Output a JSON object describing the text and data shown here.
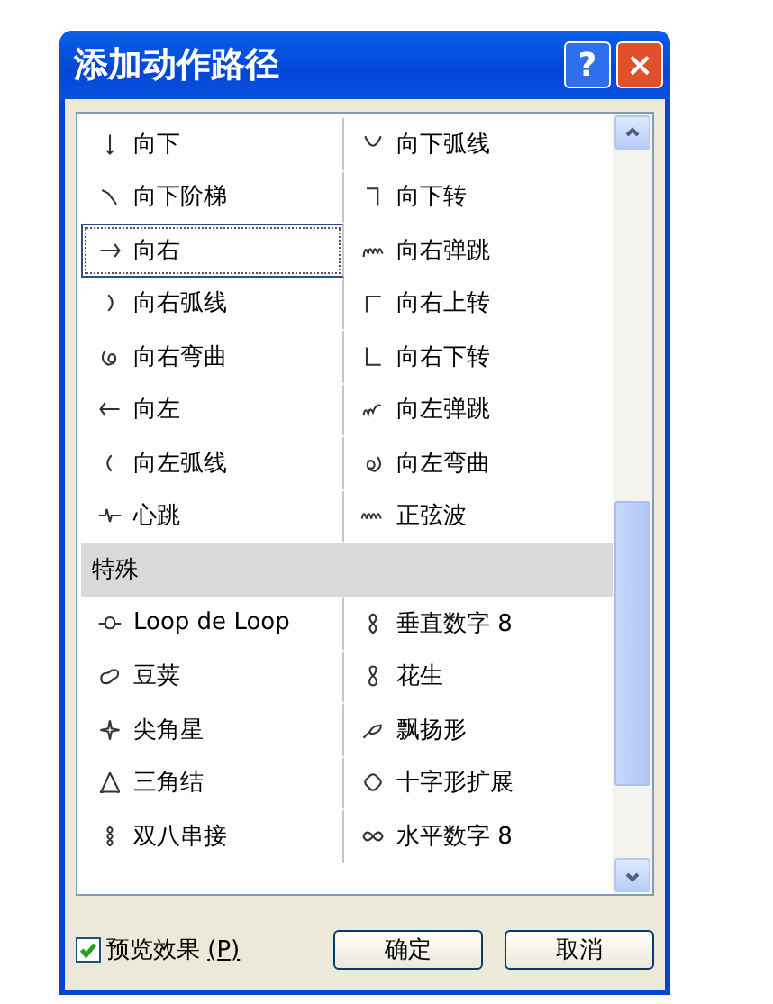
{
  "window": {
    "title": "添加动作路径",
    "help_button": "?",
    "close_button": "×"
  },
  "list": {
    "rows": [
      {
        "kind": "pair",
        "left": {
          "label": "向下",
          "selected": false
        },
        "right": {
          "label": "向下弧线",
          "selected": false
        }
      },
      {
        "kind": "pair",
        "left": {
          "label": "向下阶梯",
          "selected": false
        },
        "right": {
          "label": "向下转",
          "selected": false
        }
      },
      {
        "kind": "pair",
        "left": {
          "label": "向右",
          "selected": true
        },
        "right": {
          "label": "向右弹跳",
          "selected": false
        }
      },
      {
        "kind": "pair",
        "left": {
          "label": "向右弧线",
          "selected": false
        },
        "right": {
          "label": "向右上转",
          "selected": false
        }
      },
      {
        "kind": "pair",
        "left": {
          "label": "向右弯曲",
          "selected": false
        },
        "right": {
          "label": "向右下转",
          "selected": false
        }
      },
      {
        "kind": "pair",
        "left": {
          "label": "向左",
          "selected": false
        },
        "right": {
          "label": "向左弹跳",
          "selected": false
        }
      },
      {
        "kind": "pair",
        "left": {
          "label": "向左弧线",
          "selected": false
        },
        "right": {
          "label": "向左弯曲",
          "selected": false
        }
      },
      {
        "kind": "pair",
        "left": {
          "label": "心跳",
          "selected": false
        },
        "right": {
          "label": "正弦波",
          "selected": false
        }
      },
      {
        "kind": "header",
        "label": "特殊"
      },
      {
        "kind": "pair",
        "left": {
          "label": "Loop de Loop",
          "selected": false
        },
        "right": {
          "label": "垂直数字 8",
          "selected": false
        }
      },
      {
        "kind": "pair",
        "left": {
          "label": "豆荚",
          "selected": false
        },
        "right": {
          "label": "花生",
          "selected": false
        }
      },
      {
        "kind": "pair",
        "left": {
          "label": "尖角星",
          "selected": false
        },
        "right": {
          "label": "飘扬形",
          "selected": false
        }
      },
      {
        "kind": "pair",
        "left": {
          "label": "三角结",
          "selected": false
        },
        "right": {
          "label": "十字形扩展",
          "selected": false
        }
      },
      {
        "kind": "pair",
        "left": {
          "label": "双八串接",
          "selected": false
        },
        "right": {
          "label": "水平数字 8",
          "selected": false
        }
      }
    ]
  },
  "preview": {
    "label": "预览效果",
    "mnemonic": "(P)",
    "checked": true
  },
  "buttons": [
    "确定",
    "取消"
  ]
}
